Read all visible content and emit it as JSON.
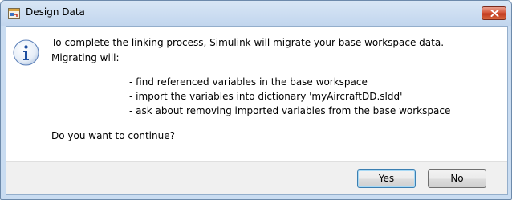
{
  "window": {
    "title": "Design Data"
  },
  "message": {
    "line1": "To complete the linking process, Simulink will migrate your base workspace data.",
    "line2": "Migrating will:",
    "bullets": [
      "- find referenced variables in the base workspace",
      "- import the variables into dictionary 'myAircraftDD.sldd'",
      "- ask about removing imported variables from the base workspace"
    ],
    "question": "Do you want to continue?"
  },
  "buttons": {
    "yes_label": "Yes",
    "no_label": "No"
  },
  "icons": {
    "app": "simulink-design-data-icon",
    "info": "info-icon",
    "close": "close-icon"
  },
  "colors": {
    "titlebar": "#c9dcf1",
    "close_button": "#c9432a",
    "info_icon": "#3b73c4"
  }
}
